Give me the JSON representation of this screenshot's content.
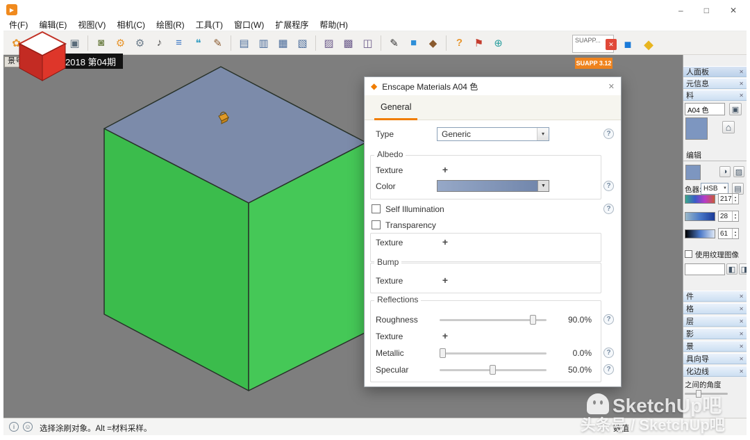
{
  "colors": {
    "enscape_orange": "#f07d00",
    "suapp_orange": "#f0841e",
    "box_top": "#7c8baa",
    "box_left": "#3bbc4c",
    "box_right": "#45c857",
    "material_blue": "#7d96c0"
  },
  "glyphs": {
    "play": "▶",
    "minimize": "–",
    "maximize": "□",
    "close": "✕",
    "combo_arrow": "▾",
    "dropdown_arrow": "▼",
    "plus": "+",
    "question": "?",
    "spin_up": "▲",
    "spin_down": "▼",
    "house": "⌂",
    "info": "i",
    "user": "☺",
    "panel_close": "✕",
    "pane": "▣",
    "wheel": "◑",
    "pick": "▨",
    "swatch": "▤",
    "bucket1": "◧",
    "bucket2": "◨"
  },
  "menu": {
    "items": [
      "件(F)",
      "编辑(E)",
      "视图(V)",
      "相机(C)",
      "绘图(R)",
      "工具(T)",
      "窗口(W)",
      "扩展程序",
      "帮助(H)"
    ]
  },
  "toolbar": {
    "icons": [
      {
        "name": "paint-flower-icon",
        "glyph": "✿"
      },
      {
        "name": "red-component-icon",
        "glyph": "❖"
      },
      {
        "name": "select-arrow-icon",
        "glyph": "➤"
      },
      {
        "name": "screen-view-icon",
        "glyph": "▣"
      },
      {
        "name": "stamp-icon",
        "glyph": "◙"
      },
      {
        "name": "orange-gear-icon",
        "glyph": "⚙"
      },
      {
        "name": "gray-gear-icon",
        "glyph": "⚙"
      },
      {
        "name": "speaker-icon",
        "glyph": "♪"
      },
      {
        "name": "list-icon",
        "glyph": "≡"
      },
      {
        "name": "chat-bubble-icon",
        "glyph": "❝"
      },
      {
        "name": "brush-box-icon",
        "glyph": "✎"
      },
      {
        "name": "panel-view-1-icon",
        "glyph": "▤"
      },
      {
        "name": "panel-view-2-icon",
        "glyph": "▥"
      },
      {
        "name": "panel-view-3-icon",
        "glyph": "▦"
      },
      {
        "name": "panel-view-4-icon",
        "glyph": "▧"
      },
      {
        "name": "image-export-1-icon",
        "glyph": "▨"
      },
      {
        "name": "image-export-2-icon",
        "glyph": "▩"
      },
      {
        "name": "image-export-3-icon",
        "glyph": "◫"
      },
      {
        "name": "pencil-icon",
        "glyph": "✎"
      },
      {
        "name": "fill-blue-icon",
        "glyph": "■"
      },
      {
        "name": "material-cube-icon",
        "glyph": "◆"
      },
      {
        "name": "help-icon",
        "glyph": "?"
      },
      {
        "name": "walkthrough-icon",
        "glyph": "⚑"
      },
      {
        "name": "compass-icon",
        "glyph": "⊕"
      }
    ],
    "suapp_box_label": "SUAPP...",
    "suapp_badge": "SUAPP 3.12",
    "enscape_square_glyph": "■",
    "enscape_hex_glyph": "◆"
  },
  "overlay": {
    "badge": "2018 第04期",
    "scene_tab": "景号2"
  },
  "dialog": {
    "title": "Enscape Materials A04 色",
    "tab_general": "General",
    "rows": {
      "type_label": "Type",
      "type_value": "Generic",
      "albedo_legend": "Albedo",
      "texture_label": "Texture",
      "color_label": "Color",
      "self_illumination_label": "Self Illumination",
      "transparency_label": "Transparency",
      "bump_legend": "Bump",
      "reflections_legend": "Reflections",
      "roughness_label": "Roughness",
      "roughness_value": "90.0%",
      "metallic_label": "Metallic",
      "metallic_value": "0.0%",
      "specular_label": "Specular",
      "specular_value": "50.0%"
    }
  },
  "right_panel": {
    "tray_header": "人面板",
    "entity_info": "元信息",
    "materials": "料",
    "material_name": "A04 色",
    "edit_tab": "编辑",
    "picker_label": "色器:",
    "picker_value": "HSB",
    "hue": "217",
    "saturation": "28",
    "brightness": "61",
    "use_texture": "使用纹理图像",
    "panels": [
      "件",
      "格",
      "层",
      "影",
      "景",
      "具向导",
      "化边线"
    ],
    "soften_label": "之间的角度"
  },
  "statusbar": {
    "hint": "选择涂刷对象。Alt =材料采样。",
    "measure_label": "数值"
  },
  "watermark": {
    "line1": "SketchUp吧",
    "line2": "头条号 / SketchUp吧"
  }
}
